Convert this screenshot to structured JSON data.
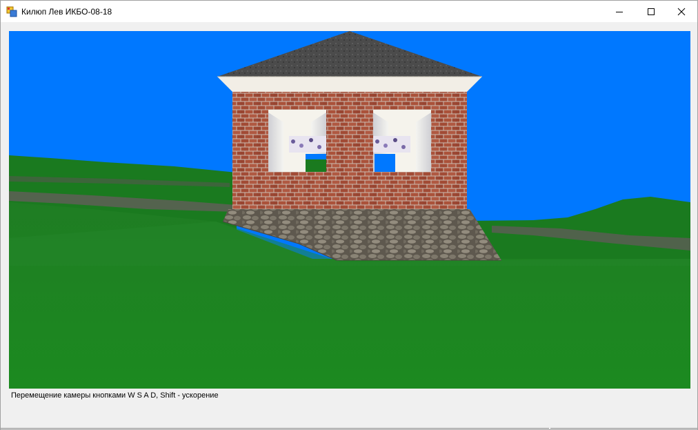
{
  "window": {
    "title": "Килюп Лев ИКБО-08-18",
    "icon": "app-window-icon",
    "controls": {
      "minimize_icon": "minimize-icon",
      "maximize_icon": "maximize-icon",
      "close_icon": "close-icon"
    }
  },
  "scene": {
    "sky_color": "#0078ff",
    "grass_color": "#1a7a1f",
    "roof_color": "#4a4a4a",
    "brick_color": "#a6533c",
    "foundation_color": "#7d7668"
  },
  "status": {
    "text": "Перемещение камеры кнопками W S A D, Shift - ускорение"
  }
}
